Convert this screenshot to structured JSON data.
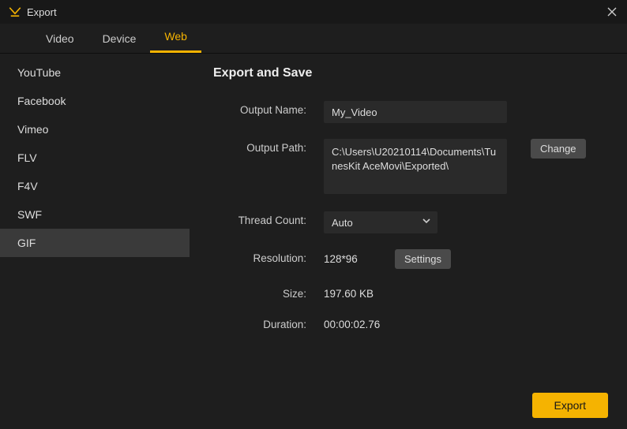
{
  "window": {
    "title": "Export"
  },
  "tabs": [
    {
      "label": "Video"
    },
    {
      "label": "Device"
    },
    {
      "label": "Web"
    }
  ],
  "activeTabIndex": 2,
  "sidebar": {
    "items": [
      {
        "label": "YouTube"
      },
      {
        "label": "Facebook"
      },
      {
        "label": "Vimeo"
      },
      {
        "label": "FLV"
      },
      {
        "label": "F4V"
      },
      {
        "label": "SWF"
      },
      {
        "label": "GIF"
      }
    ],
    "activeIndex": 6
  },
  "content": {
    "heading": "Export and Save",
    "outputName": {
      "label": "Output Name:",
      "value": "My_Video"
    },
    "outputPath": {
      "label": "Output Path:",
      "value": "C:\\Users\\U20210114\\Documents\\TunesKit AceMovi\\Exported\\",
      "changeLabel": "Change"
    },
    "threadCount": {
      "label": "Thread Count:",
      "value": "Auto"
    },
    "resolution": {
      "label": "Resolution:",
      "value": "128*96",
      "settingsLabel": "Settings"
    },
    "size": {
      "label": "Size:",
      "value": "197.60 KB"
    },
    "duration": {
      "label": "Duration:",
      "value": "00:00:02.76"
    }
  },
  "footer": {
    "exportLabel": "Export"
  }
}
